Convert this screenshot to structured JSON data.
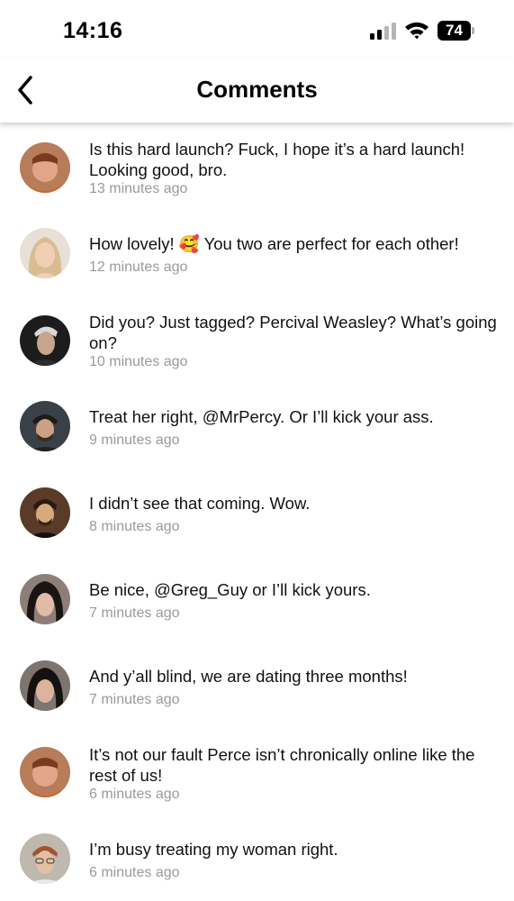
{
  "status_bar": {
    "time": "14:16",
    "battery": "74"
  },
  "header": {
    "title": "Comments"
  },
  "comments": [
    {
      "text": "Is this hard launch? Fuck, I hope it’s a hard launch! Looking good, bro.",
      "time": "13 minutes ago"
    },
    {
      "text": "How lovely! 🥰  You two are perfect for each other!",
      "time": "12 minutes ago"
    },
    {
      "text": "Did you? Just tagged? Percival Weasley? What’s going on?",
      "time": "10 minutes ago"
    },
    {
      "text": "Treat her right, @MrPercy. Or I’ll kick your ass.",
      "time": "9 minutes ago"
    },
    {
      "text": "I didn’t see that coming. Wow.",
      "time": "8 minutes ago"
    },
    {
      "text": "Be nice, @Greg_Guy or I’ll kick yours.",
      "time": "7 minutes ago"
    },
    {
      "text": "And y’all blind, we are dating three months!",
      "time": "7 minutes ago"
    },
    {
      "text": "It’s not our fault Perce isn’t chronically online like the rest of us!",
      "time": "6 minutes ago"
    },
    {
      "text": "I’m busy treating my woman right.",
      "time": "6 minutes ago"
    }
  ]
}
